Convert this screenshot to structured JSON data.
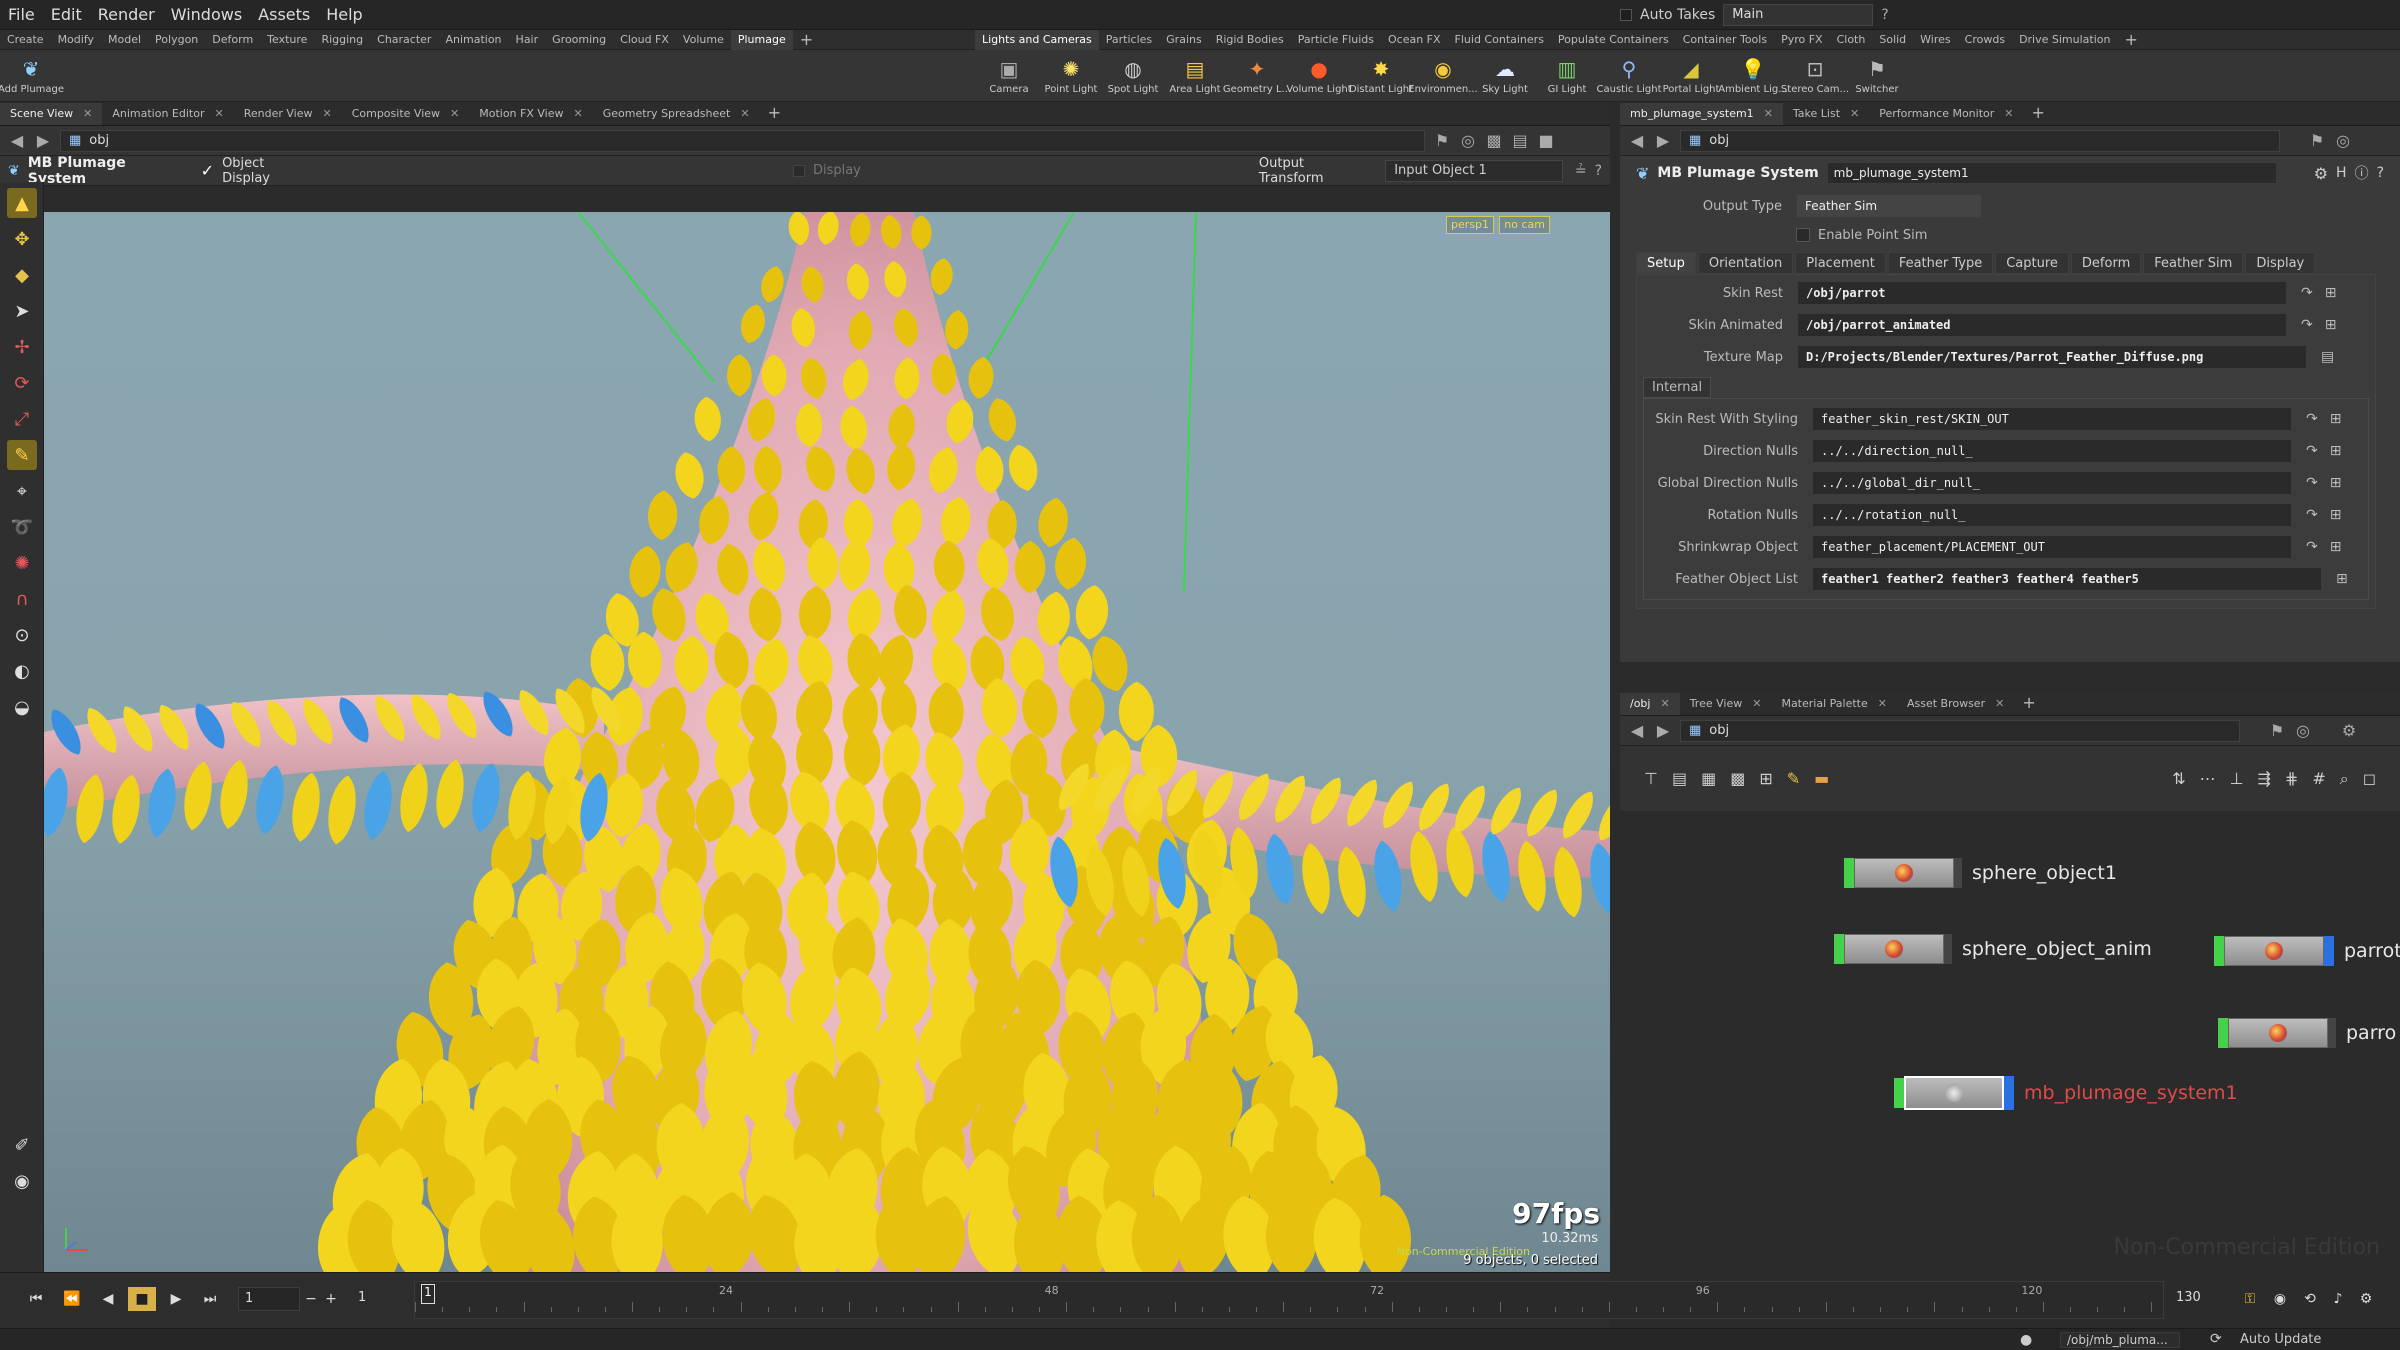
{
  "menu": [
    "File",
    "Edit",
    "Render",
    "Windows",
    "Assets",
    "Help"
  ],
  "menu_right": {
    "auto_takes": "Auto Takes",
    "desktop": "Main"
  },
  "shelf_left": [
    "Create",
    "Modify",
    "Model",
    "Polygon",
    "Deform",
    "Texture",
    "Rigging",
    "Character",
    "Animation",
    "Hair",
    "Grooming",
    "Cloud FX",
    "Volume",
    "Plumage"
  ],
  "shelf_right": [
    "Lights and Cameras",
    "Particles",
    "Grains",
    "Rigid Bodies",
    "Particle Fluids",
    "Ocean FX",
    "Fluid Containers",
    "Populate Containers",
    "Container Tools",
    "Pyro FX",
    "Cloth",
    "Solid",
    "Wires",
    "Crowds",
    "Drive Simulation"
  ],
  "left_tool": "Add Plumage",
  "light_tools": [
    "Camera",
    "Point Light",
    "Spot Light",
    "Area Light",
    "Geometry L...",
    "Volume Light",
    "Distant Light",
    "Environmen...",
    "Sky Light",
    "GI Light",
    "Caustic Light",
    "Portal Light",
    "Ambient Lig...",
    "Stereo Cam...",
    "Switcher"
  ],
  "left_tabs": [
    "Scene View",
    "Animation Editor",
    "Render View",
    "Composite View",
    "Motion FX View",
    "Geometry Spreadsheet"
  ],
  "path": "obj",
  "viewer": {
    "title": "MB Plumage System",
    "object_display": "Object Display",
    "display": "Display",
    "output_transform": "Output Transform",
    "input": "Input Object 1",
    "persp": "persp1",
    "cam": "no cam",
    "fps": "97fps",
    "ms": "10.32ms",
    "nc": "Non-Commercial Edition",
    "objects": "9 objects, 0 selected"
  },
  "timeline": {
    "frame": "1",
    "start": "1",
    "end": "130",
    "ticks": [
      "24",
      "48",
      "72",
      "96",
      "120"
    ],
    "ticks_pos": [
      24,
      48,
      72,
      96,
      120
    ]
  },
  "right_tabs": [
    "mb_plumage_system1",
    "Take List",
    "Performance Monitor"
  ],
  "params": {
    "node_type": "MB Plumage System",
    "node_name": "mb_plumage_system1",
    "output_type_label": "Output Type",
    "output_type": "Feather Sim",
    "enable_point_sim": "Enable Point Sim",
    "tabs": [
      "Setup",
      "Orientation",
      "Placement",
      "Feather Type",
      "Capture",
      "Deform",
      "Feather Sim",
      "Display"
    ],
    "rows": [
      {
        "label": "Skin Rest",
        "value": "/obj/parrot"
      },
      {
        "label": "Skin Animated",
        "value": "/obj/parrot_animated"
      },
      {
        "label": "Texture Map",
        "value": "D:/Projects/Blender/Textures/Parrot_Feather_Diffuse.png"
      }
    ],
    "internal_label": "Internal",
    "internal_rows": [
      {
        "label": "Skin Rest With Styling",
        "value": "feather_skin_rest/SKIN_OUT"
      },
      {
        "label": "Direction Nulls",
        "value": "../../direction_null_"
      },
      {
        "label": "Global Direction Nulls",
        "value": "../../global_dir_null_"
      },
      {
        "label": "Rotation Nulls",
        "value": "../../rotation_null_"
      },
      {
        "label": "Shrinkwrap Object",
        "value": "feather_placement/PLACEMENT_OUT"
      },
      {
        "label": "Feather Object List",
        "value": "feather1 feather2 feather3 feather4 feather5"
      }
    ]
  },
  "network_tabs": [
    "/obj",
    "Tree View",
    "Material Palette",
    "Asset Browser"
  ],
  "network_path": "obj",
  "network_watermark": "Non-Commercial Edition",
  "nodes": {
    "n1": "sphere_object1",
    "n2": "sphere_object_anim",
    "n3": "parrot",
    "n4": "parro",
    "n5": "mb_plumage_system1"
  },
  "status": {
    "path": "/obj/mb_pluma...",
    "update": "Auto Update"
  },
  "colors": {
    "selected_node": "#e04a4a",
    "flag_green": "#46d14a",
    "flag_blue": "#2c6fe0",
    "feather_yellow": "#f0d21a",
    "skin_pink": "#e8b7bf",
    "sky": "#8aa6b1"
  }
}
